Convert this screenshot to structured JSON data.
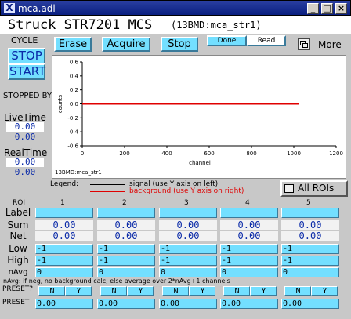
{
  "window": {
    "title": "mca.adl",
    "minimize": "_",
    "maximize": "□",
    "close": "×"
  },
  "header": {
    "title": "Struck STR7201 MCS",
    "subtitle": "(13BMD:mca_str1)"
  },
  "cycle": {
    "label": "CYCLE",
    "stop": "STOP",
    "start": "START"
  },
  "toolbar": {
    "erase": "Erase",
    "acquire": "Acquire",
    "stop": "Stop",
    "done": "Done",
    "read": "Read",
    "more": "More"
  },
  "status": {
    "state": "STOPPED BY",
    "live_label": "LiveTime",
    "live_values": [
      "0.00",
      "0.00"
    ],
    "real_label": "RealTime",
    "real_values": [
      "0.00",
      "0.00"
    ]
  },
  "chart_data": {
    "type": "line",
    "xlabel": "channel",
    "ylabel": "counts",
    "xlim": [
      0,
      1200
    ],
    "ylim": [
      -0.6,
      0.6
    ],
    "xticks": [
      "0",
      "200",
      "400",
      "600",
      "800",
      "1000",
      "1200"
    ],
    "yticks": [
      "0.6",
      "0.4",
      "0.2",
      "0.0",
      "-0.2",
      "-0.4",
      "-0.6"
    ],
    "footer": "13BMD:mca_str1",
    "series": [
      {
        "name": "signal (use Y axis on left)",
        "color": "#000000",
        "x": [
          0,
          1024
        ],
        "y": [
          0,
          0
        ]
      },
      {
        "name": "background (use Y axis on right)",
        "color": "#e00000",
        "x": [
          0,
          1024
        ],
        "y": [
          0,
          0
        ]
      }
    ]
  },
  "legend": {
    "label": "Legend:",
    "signal": "signal (use Y axis on left)",
    "background": "background (use Y axis on right)"
  },
  "all_rois": "All ROIs",
  "roi": {
    "header": "ROI",
    "columns": [
      "1",
      "2",
      "3",
      "4",
      "5"
    ],
    "row_labels": {
      "label": "Label",
      "sum": "Sum",
      "net": "Net",
      "low": "Low",
      "high": "High",
      "navg": "nAvg",
      "preset_q": "PRESET?",
      "preset": "PRESET"
    },
    "sum": [
      "0.00",
      "0.00",
      "0.00",
      "0.00",
      "0.00"
    ],
    "net": [
      "0.00",
      "0.00",
      "0.00",
      "0.00",
      "0.00"
    ],
    "low": [
      "-1",
      "-1",
      "-1",
      "-1",
      "-1"
    ],
    "high": [
      "-1",
      "-1",
      "-1",
      "-1",
      "-1"
    ],
    "navg": [
      "0",
      "0",
      "0",
      "0",
      "0"
    ],
    "preset_n": "N",
    "preset_y": "Y",
    "preset": [
      "0.00",
      "0.00",
      "0.00",
      "0.00",
      "0.00"
    ],
    "note": "nAvg: if neg, no background calc, else average over 2*nAvg+1 channels"
  }
}
